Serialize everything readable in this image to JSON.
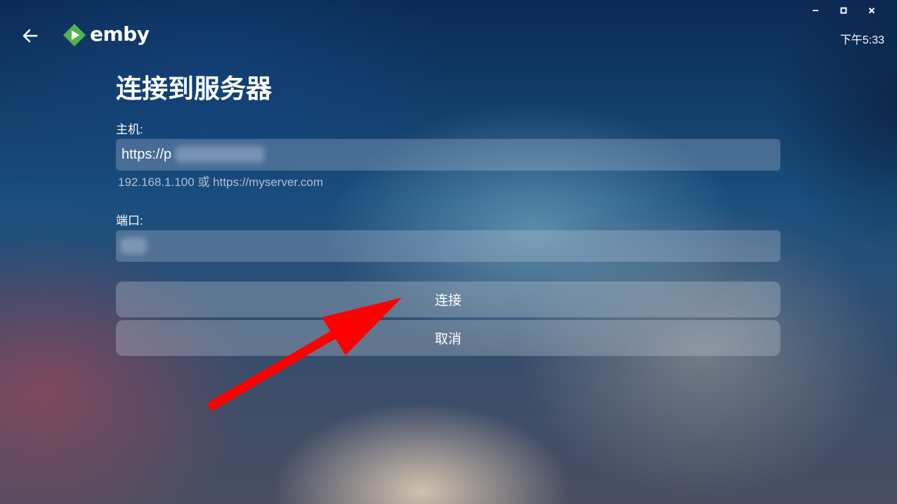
{
  "window_controls": {
    "minimize_icon": "minimize-icon",
    "maximize_icon": "maximize-icon",
    "close_icon": "close-icon"
  },
  "header": {
    "back_icon": "back-arrow-icon",
    "logo_text": "emby",
    "logo_colors": {
      "diamond": "#52b54b",
      "play": "#ffffff"
    },
    "clock": "下午5:33"
  },
  "form": {
    "title": "连接到服务器",
    "host": {
      "label": "主机:",
      "value": "https://p",
      "hint": "192.168.1.100 或 https://myserver.com"
    },
    "port": {
      "label": "端口:",
      "value": ""
    },
    "connect_label": "连接",
    "cancel_label": "取消"
  },
  "annotation": {
    "arrow_color": "#ff0000"
  }
}
